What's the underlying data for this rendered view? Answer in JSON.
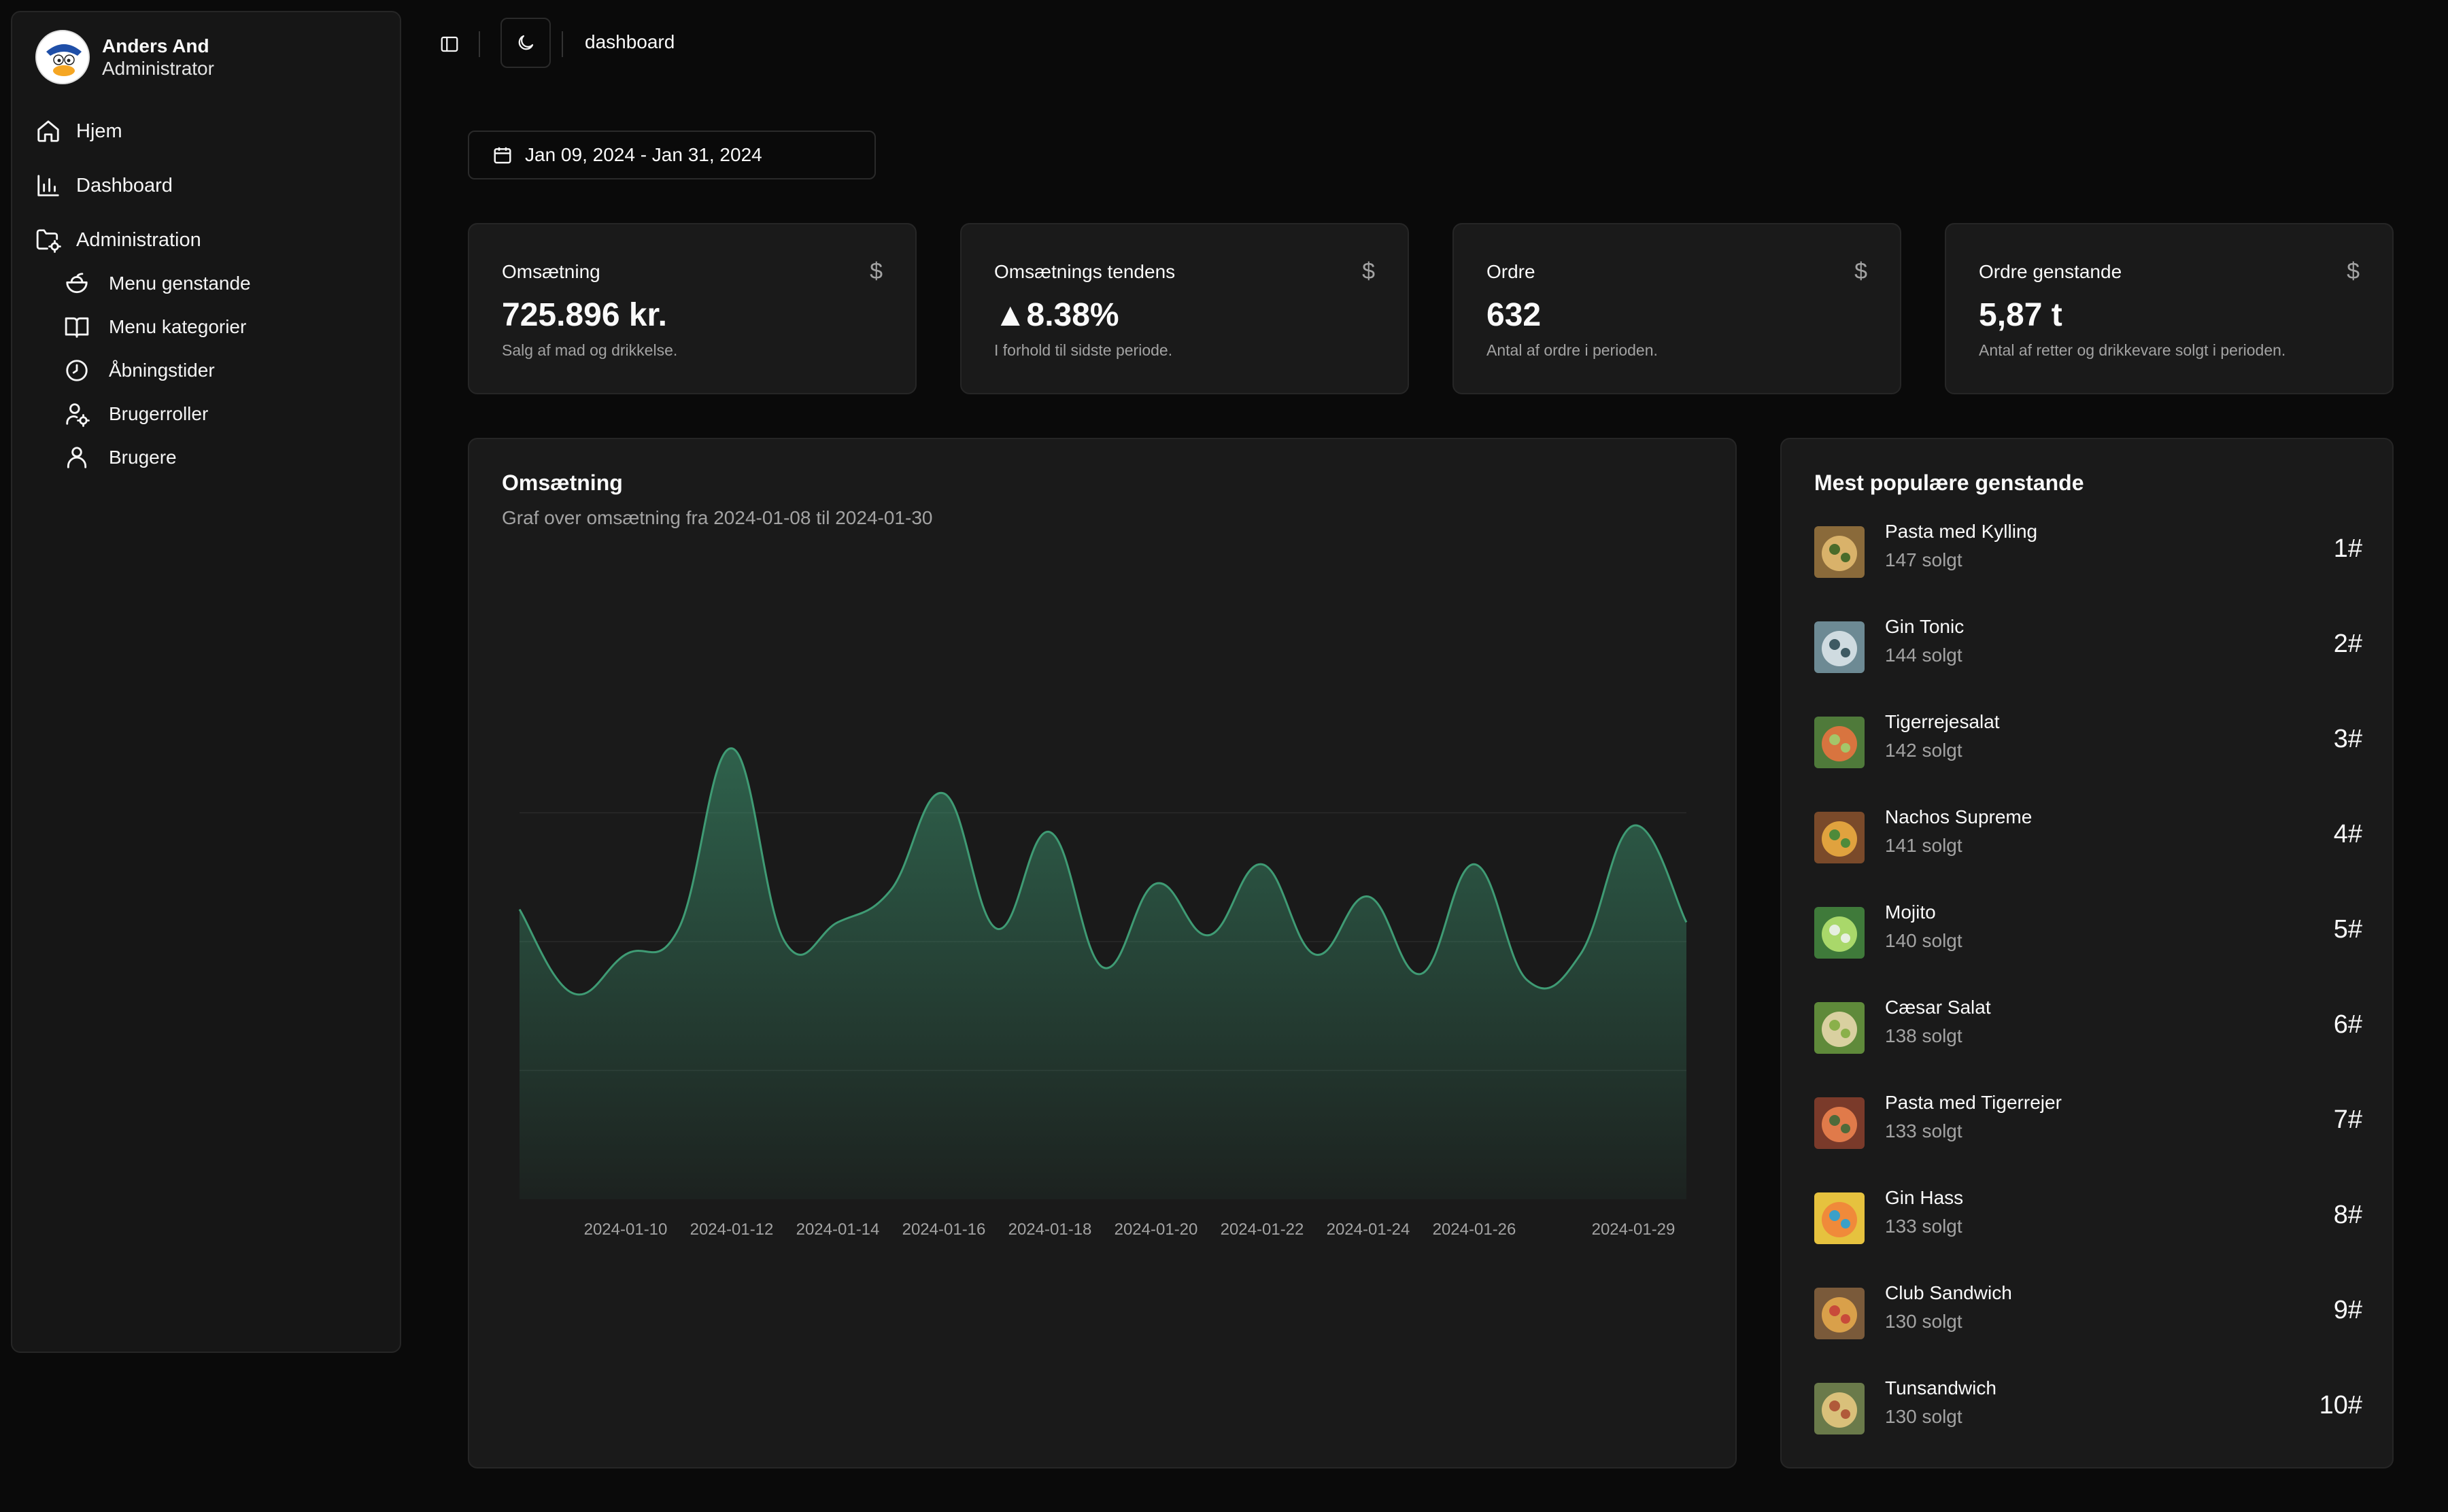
{
  "user": {
    "name": "Anders And",
    "role": "Administrator"
  },
  "nav": {
    "home": "Hjem",
    "dashboard": "Dashboard",
    "administration": "Administration",
    "sub": [
      "Menu genstande",
      "Menu kategorier",
      "Åbningstider",
      "Brugerroller",
      "Brugere"
    ]
  },
  "topbar": {
    "breadcrumb": "dashboard"
  },
  "date_range": "Jan 09, 2024 - Jan 31, 2024",
  "stats": [
    {
      "title": "Omsætning",
      "icon": "$",
      "value": "725.896 kr.",
      "desc": "Salg af mad og drikkelse."
    },
    {
      "title": "Omsætnings tendens",
      "icon": "$",
      "value": "▲8.38%",
      "desc": "I forhold til sidste periode."
    },
    {
      "title": "Ordre",
      "icon": "$",
      "value": "632",
      "desc": "Antal af ordre i perioden."
    },
    {
      "title": "Ordre genstande",
      "icon": "$",
      "value": "5,87 t",
      "desc": "Antal af retter og drikkevare solgt i perioden."
    }
  ],
  "revenue_chart": {
    "title": "Omsætning",
    "subtitle": "Graf over omsætning fra 2024-01-08 til 2024-01-30"
  },
  "chart_data": {
    "type": "area",
    "x": [
      "2024-01-08",
      "2024-01-09",
      "2024-01-10",
      "2024-01-11",
      "2024-01-12",
      "2024-01-13",
      "2024-01-14",
      "2024-01-15",
      "2024-01-16",
      "2024-01-17",
      "2024-01-18",
      "2024-01-19",
      "2024-01-20",
      "2024-01-21",
      "2024-01-22",
      "2024-01-23",
      "2024-01-24",
      "2024-01-25",
      "2024-01-26",
      "2024-01-27",
      "2024-01-28",
      "2024-01-29",
      "2024-01-30"
    ],
    "values": [
      22500,
      16000,
      19000,
      21000,
      35000,
      20000,
      21500,
      24000,
      31500,
      21000,
      28500,
      18000,
      24500,
      20500,
      26000,
      19000,
      23500,
      17500,
      26000,
      17000,
      19000,
      29000,
      21500
    ],
    "xtick_labels": [
      "2024-01-10",
      "2024-01-12",
      "2024-01-14",
      "2024-01-16",
      "2024-01-18",
      "2024-01-20",
      "2024-01-22",
      "2024-01-24",
      "2024-01-26",
      "2024-01-29"
    ],
    "ylim": [
      0,
      40000
    ],
    "grid": true,
    "color": "#3f9b74"
  },
  "popular": {
    "title": "Mest populære genstande",
    "items": [
      {
        "name": "Pasta med Kylling",
        "sold": "147 solgt",
        "rank": "1#"
      },
      {
        "name": "Gin Tonic",
        "sold": "144 solgt",
        "rank": "2#"
      },
      {
        "name": "Tigerrejesalat",
        "sold": "142 solgt",
        "rank": "3#"
      },
      {
        "name": "Nachos Supreme",
        "sold": "141 solgt",
        "rank": "4#"
      },
      {
        "name": "Mojito",
        "sold": "140 solgt",
        "rank": "5#"
      },
      {
        "name": "Cæsar Salat",
        "sold": "138 solgt",
        "rank": "6#"
      },
      {
        "name": "Pasta med Tigerrejer",
        "sold": "133 solgt",
        "rank": "7#"
      },
      {
        "name": "Gin Hass",
        "sold": "133 solgt",
        "rank": "8#"
      },
      {
        "name": "Club Sandwich",
        "sold": "130 solgt",
        "rank": "9#"
      },
      {
        "name": "Tunsandwich",
        "sold": "130 solgt",
        "rank": "10#"
      }
    ]
  }
}
